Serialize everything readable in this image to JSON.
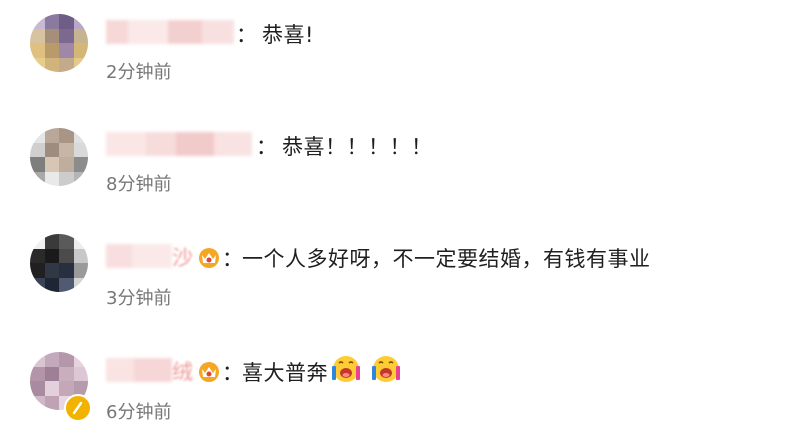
{
  "comments": [
    {
      "separator": "：",
      "text": "恭喜!",
      "time": "2分钟前"
    },
    {
      "separator": "：",
      "text": "恭喜！！！！！",
      "time": "8分钟前"
    },
    {
      "name_visible": "沙",
      "separator": "：",
      "text": "一个人多好呀，不一定要结婚，有钱有事业",
      "time": "3分钟前"
    },
    {
      "name_visible": "绒",
      "separator": "：",
      "text": "喜大普奔",
      "time": "6分钟前"
    }
  ],
  "colors": {
    "text": "#1f1f1f",
    "timestamp": "#777777",
    "name_accent": "#f08f8f",
    "vip_badge": "#f5a623"
  }
}
